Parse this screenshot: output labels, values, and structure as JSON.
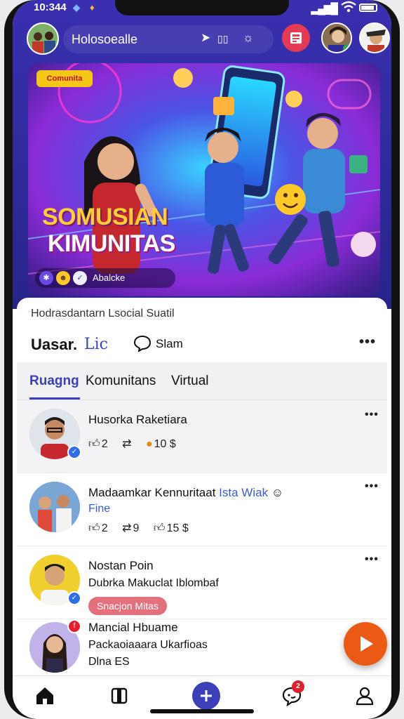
{
  "status": {
    "time": "10:344"
  },
  "header": {
    "search_text": "Holosoealle",
    "search_icon_1": "send-icon",
    "search_icon_2": "grid-icon",
    "search_icon_3": "spark-icon"
  },
  "banner": {
    "tag": "Comunita",
    "title_line1": "SOMUSIAN",
    "title_line2": "KIMUNITAS",
    "footer_text": "Abalcke"
  },
  "feed": {
    "subtitle": "Hodrasdantarn Lsocial Suatil",
    "action_user": "Uasar.",
    "action_like": "Lic",
    "action_comment": "Slam",
    "tabs": [
      "Ruagng",
      "Komunitans",
      "Virtual"
    ],
    "posts": [
      {
        "name": "Husorka Raketiara",
        "likes": "2",
        "shares": "",
        "count": "10 $"
      },
      {
        "name": "Madaamkar Kennuritaat",
        "name_link": "Ista Wiak",
        "line2": "Fine",
        "likes": "2",
        "shares": "9",
        "count": "15 $"
      },
      {
        "name": "Nostan Poin",
        "line2": "Dubrka Makuclat Iblombaf",
        "pill": "Snacjon Mitas"
      },
      {
        "name": "Mancial Hbuame",
        "line2": "Packaoiaaara Ukarfioas",
        "line3": "Dlna ES"
      }
    ]
  },
  "nav": {
    "notif_count": "2"
  },
  "colors": {
    "header_bg": "#2e2a9a",
    "accent": "#3b3fb8",
    "fab": "#ea5a14",
    "pill": "#e2717d"
  }
}
